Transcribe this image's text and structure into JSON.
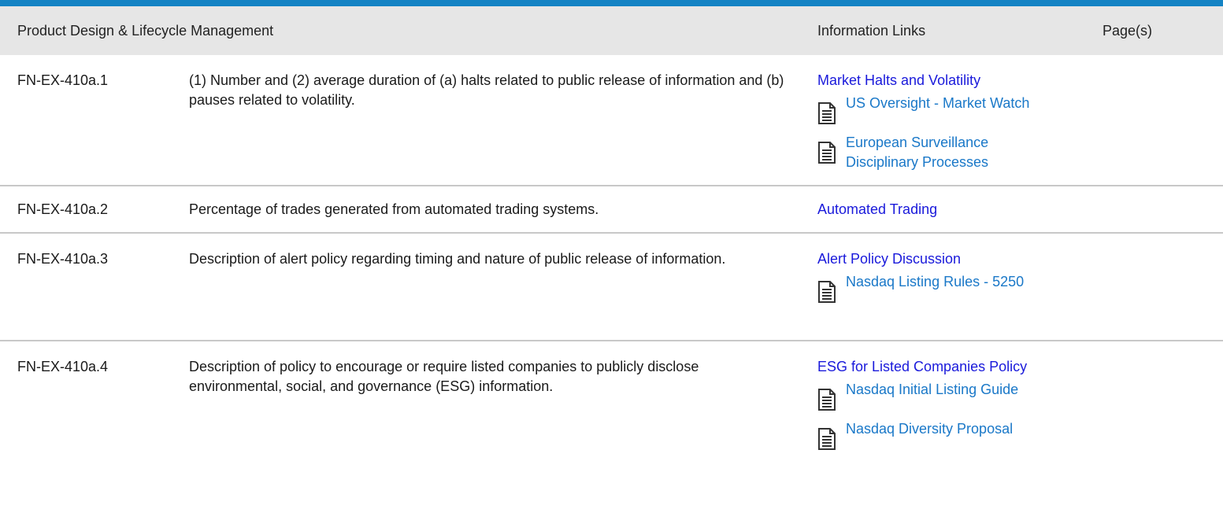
{
  "header": {
    "section": "Product Design & Lifecycle Management",
    "links": "Information Links",
    "pages": "Page(s)"
  },
  "rows": [
    {
      "code": "FN-EX-410a.1",
      "description": "(1) Number and (2) average duration of (a) halts related to public release of information and (b) pauses related to volatility.",
      "main_link": "Market Halts and Volatility",
      "sub_links": [
        "US Oversight - Market Watch",
        "European Surveillance Disciplinary Processes"
      ]
    },
    {
      "code": "FN-EX-410a.2",
      "description": "Percentage of trades generated from automated trading systems.",
      "main_link": "Automated Trading",
      "sub_links": []
    },
    {
      "code": "FN-EX-410a.3",
      "description": "Description of alert policy regarding timing and nature of public release of information.",
      "main_link": "Alert Policy Discussion",
      "sub_links": [
        "Nasdaq Listing Rules - 5250"
      ]
    },
    {
      "code": "FN-EX-410a.4",
      "description": "Description of policy to encourage or require listed companies to publicly disclose environmental, social, and governance (ESG) information.",
      "main_link": "ESG for Listed Companies Policy",
      "sub_links": [
        "Nasdaq Initial Listing Guide",
        "Nasdaq Diversity Proposal"
      ]
    }
  ],
  "icons": {
    "sub_link_icon": "document-icon"
  },
  "colors": {
    "top_border": "#1483c4",
    "header_bg": "#e6e6e6",
    "main_link": "#1a1adb",
    "sub_link": "#1a78c8"
  }
}
